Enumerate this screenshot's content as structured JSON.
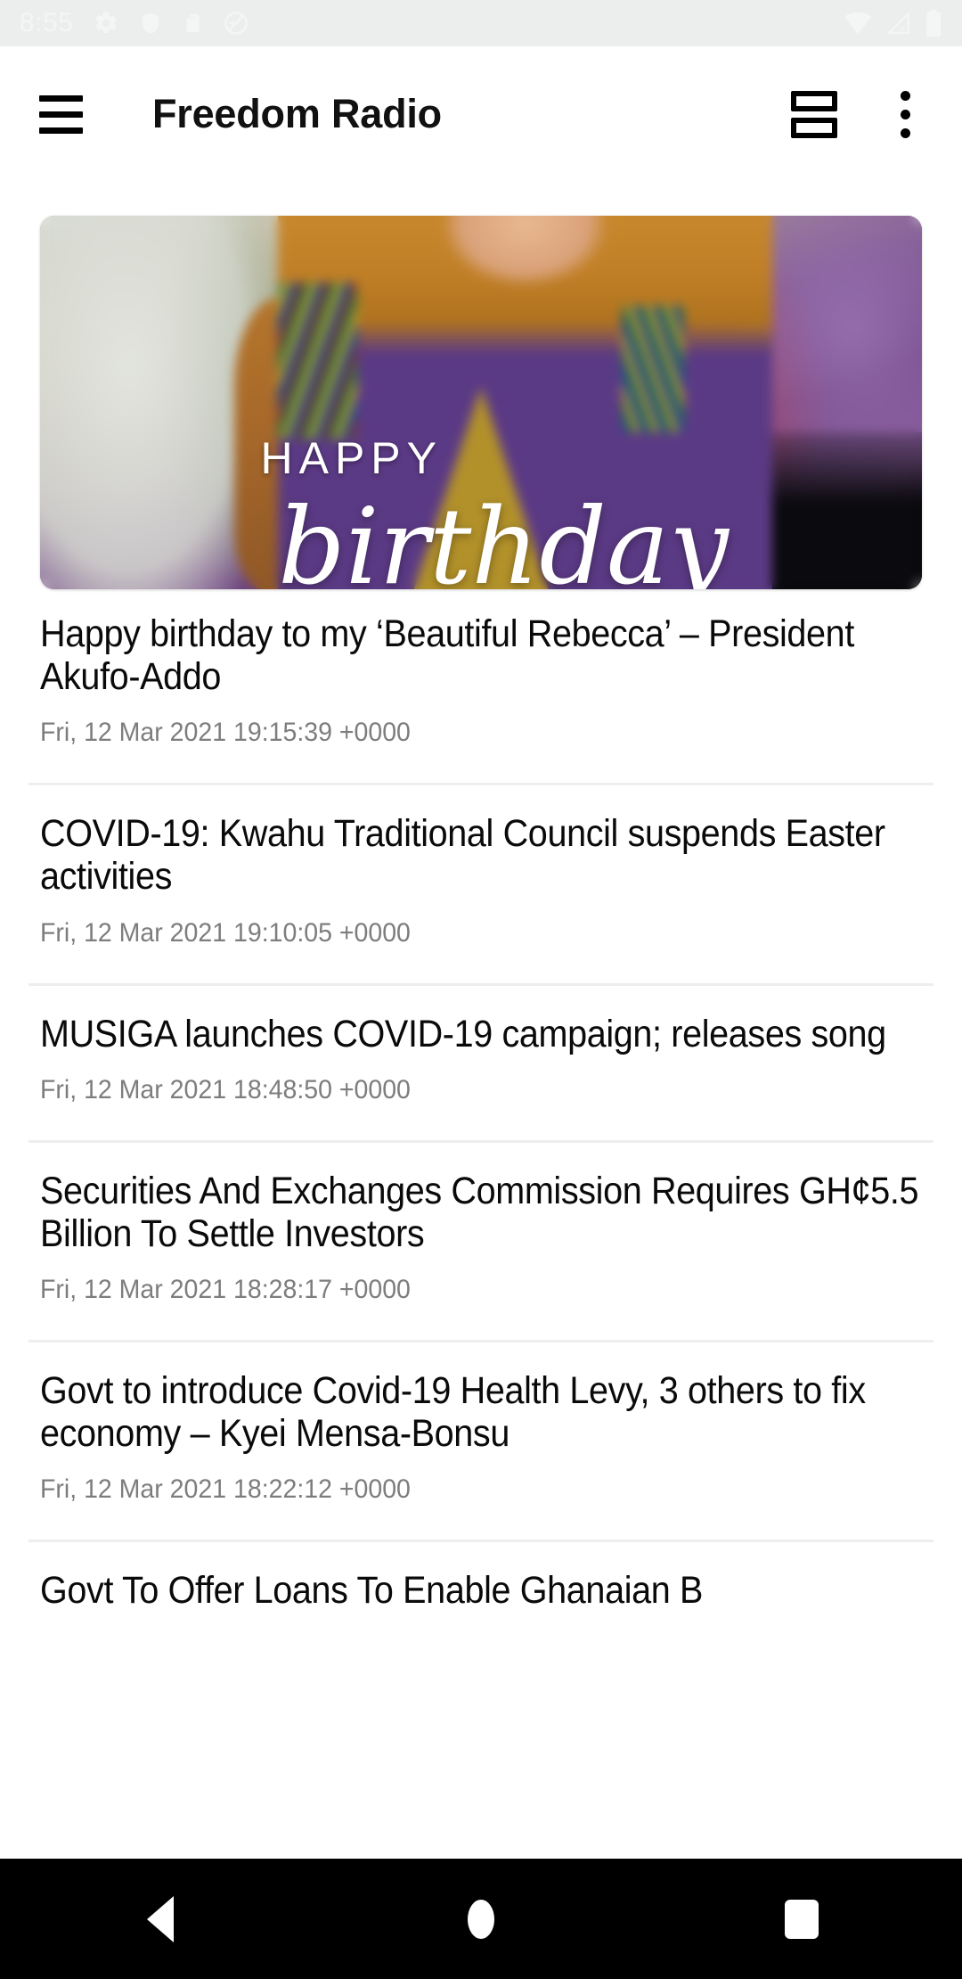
{
  "status_bar": {
    "time": "8:55",
    "left_icons": [
      "gear-icon",
      "shield-icon",
      "sd-card-icon",
      "no-sound-icon"
    ],
    "right_icons": [
      "wifi-icon",
      "cellular-signal-icon",
      "battery-icon"
    ],
    "background_color": "#eceded",
    "icon_color": "#f4f5f5"
  },
  "appbar": {
    "menu_icon": "hamburger-menu-icon",
    "title": "Freedom Radio",
    "layout_toggle_icon": "list-layout-toggle-icon",
    "overflow_icon": "more-vertical-icon",
    "background_color": "#ffffff",
    "text_color": "#111111"
  },
  "hero": {
    "alt": "Person in colorful kente print outfit with Happy Birthday overlay",
    "overlay_line1": "HAPPY",
    "overlay_line2": "birthday"
  },
  "articles": [
    {
      "title": "Happy birthday to my ‘Beautiful Rebecca’ – President Akufo-Addo",
      "date": "Fri, 12 Mar 2021 19:15:39 +0000"
    },
    {
      "title": "COVID-19: Kwahu Traditional Council suspends Easter activities",
      "date": "Fri, 12 Mar 2021 19:10:05 +0000"
    },
    {
      "title": "MUSIGA launches COVID-19 campaign; releases song",
      "date": "Fri, 12 Mar 2021 18:48:50 +0000"
    },
    {
      "title": "Securities And Exchanges Commission Requires GH¢5.5 Billion To Settle Investors",
      "date": "Fri, 12 Mar 2021 18:28:17 +0000"
    },
    {
      "title": "Govt to introduce Covid-19 Health Levy, 3 others to fix economy – Kyei Mensa-Bonsu",
      "date": "Fri, 12 Mar 2021 18:22:12 +0000"
    },
    {
      "title": "Govt To Offer Loans To Enable Ghanaian B",
      "date": ""
    }
  ],
  "navbar": {
    "back_icon": "back-triangle-icon",
    "home_icon": "home-circle-icon",
    "recents_icon": "recents-square-icon",
    "background_color": "#000000"
  },
  "colors": {
    "divider": "#eceef0",
    "date_text": "#7d7d7d",
    "title_text": "#0a0a0a"
  }
}
